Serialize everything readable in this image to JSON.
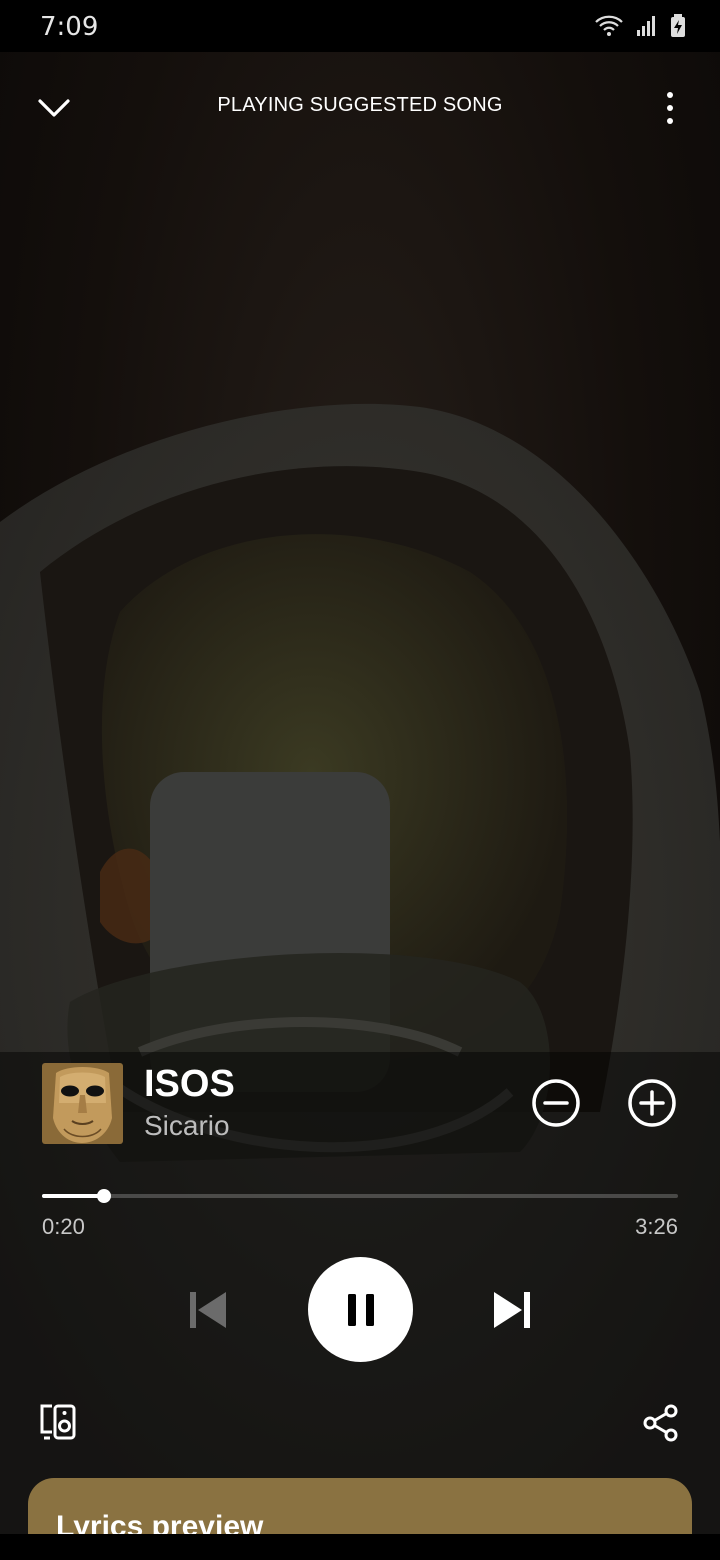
{
  "status_bar": {
    "time": "7:09",
    "icons": [
      "wifi-icon",
      "signal-icon",
      "battery-charging-icon"
    ]
  },
  "header": {
    "title": "PLAYING SUGGESTED SONG",
    "left_icon": "chevron-down-icon",
    "right_icon": "more-vertical-icon"
  },
  "track": {
    "title": "ISOS",
    "artist": "Sicario",
    "album_art_icon": "golden-mask-album-art"
  },
  "playback": {
    "elapsed": "0:20",
    "total": "3:26",
    "progress_fraction": 0.097,
    "state": "playing"
  },
  "controls": {
    "remove_icon": "minus-circle-icon",
    "add_icon": "plus-circle-icon",
    "prev_icon": "skip-previous-icon",
    "pause_icon": "pause-icon",
    "next_icon": "skip-next-icon",
    "devices_icon": "connect-devices-icon",
    "share_icon": "share-icon"
  },
  "lyrics": {
    "label": "Lyrics preview",
    "card_color": "#8a7241"
  },
  "colors": {
    "background": "#120e0b",
    "text_primary": "#ffffff",
    "text_secondary": "#bdbdbd"
  }
}
